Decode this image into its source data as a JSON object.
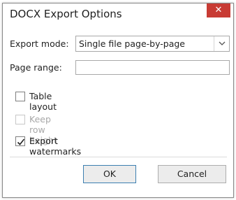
{
  "dialog": {
    "title": "DOCX Export Options",
    "close_glyph": "✕"
  },
  "export_mode": {
    "label": "Export mode:",
    "selected": "Single file page-by-page"
  },
  "page_range": {
    "label": "Page range:",
    "value": ""
  },
  "options": [
    {
      "label": "Table layout",
      "checked": false,
      "enabled": true
    },
    {
      "label": "Keep row height",
      "checked": false,
      "enabled": false
    },
    {
      "label": "Export watermarks",
      "checked": true,
      "enabled": true
    }
  ],
  "buttons": {
    "ok": "OK",
    "cancel": "Cancel"
  },
  "colors": {
    "close_button": "#c83b34",
    "default_button_border": "#3c7fb1"
  }
}
